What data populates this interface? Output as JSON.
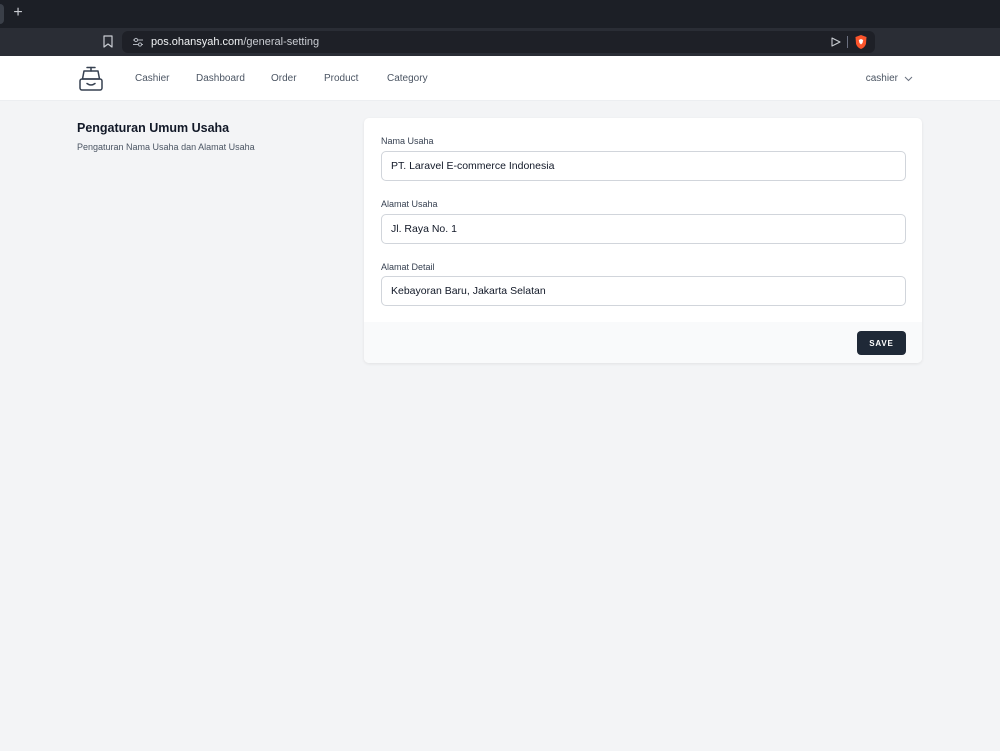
{
  "browser": {
    "new_tab_label": "+",
    "url_host": "pos.ohansyah.com",
    "url_path": "/general-setting"
  },
  "nav": {
    "items": [
      "Cashier",
      "Dashboard",
      "Order",
      "Product",
      "Category"
    ],
    "user": "cashier"
  },
  "section": {
    "title": "Pengaturan Umum Usaha",
    "description": "Pengaturan Nama Usaha dan Alamat Usaha"
  },
  "form": {
    "fields": [
      {
        "label": "Nama Usaha",
        "value": "PT. Laravel E-commerce Indonesia"
      },
      {
        "label": "Alamat Usaha",
        "value": "Jl. Raya No. 1"
      },
      {
        "label": "Alamat Detail",
        "value": "Kebayoran Baru, Jakarta Selatan"
      }
    ],
    "save_label": "SAVE"
  },
  "colors": {
    "nav_bg": "#ffffff",
    "page_bg": "#f3f4f6",
    "button_bg": "#1f2937",
    "brave_orange": "#fb542b"
  }
}
